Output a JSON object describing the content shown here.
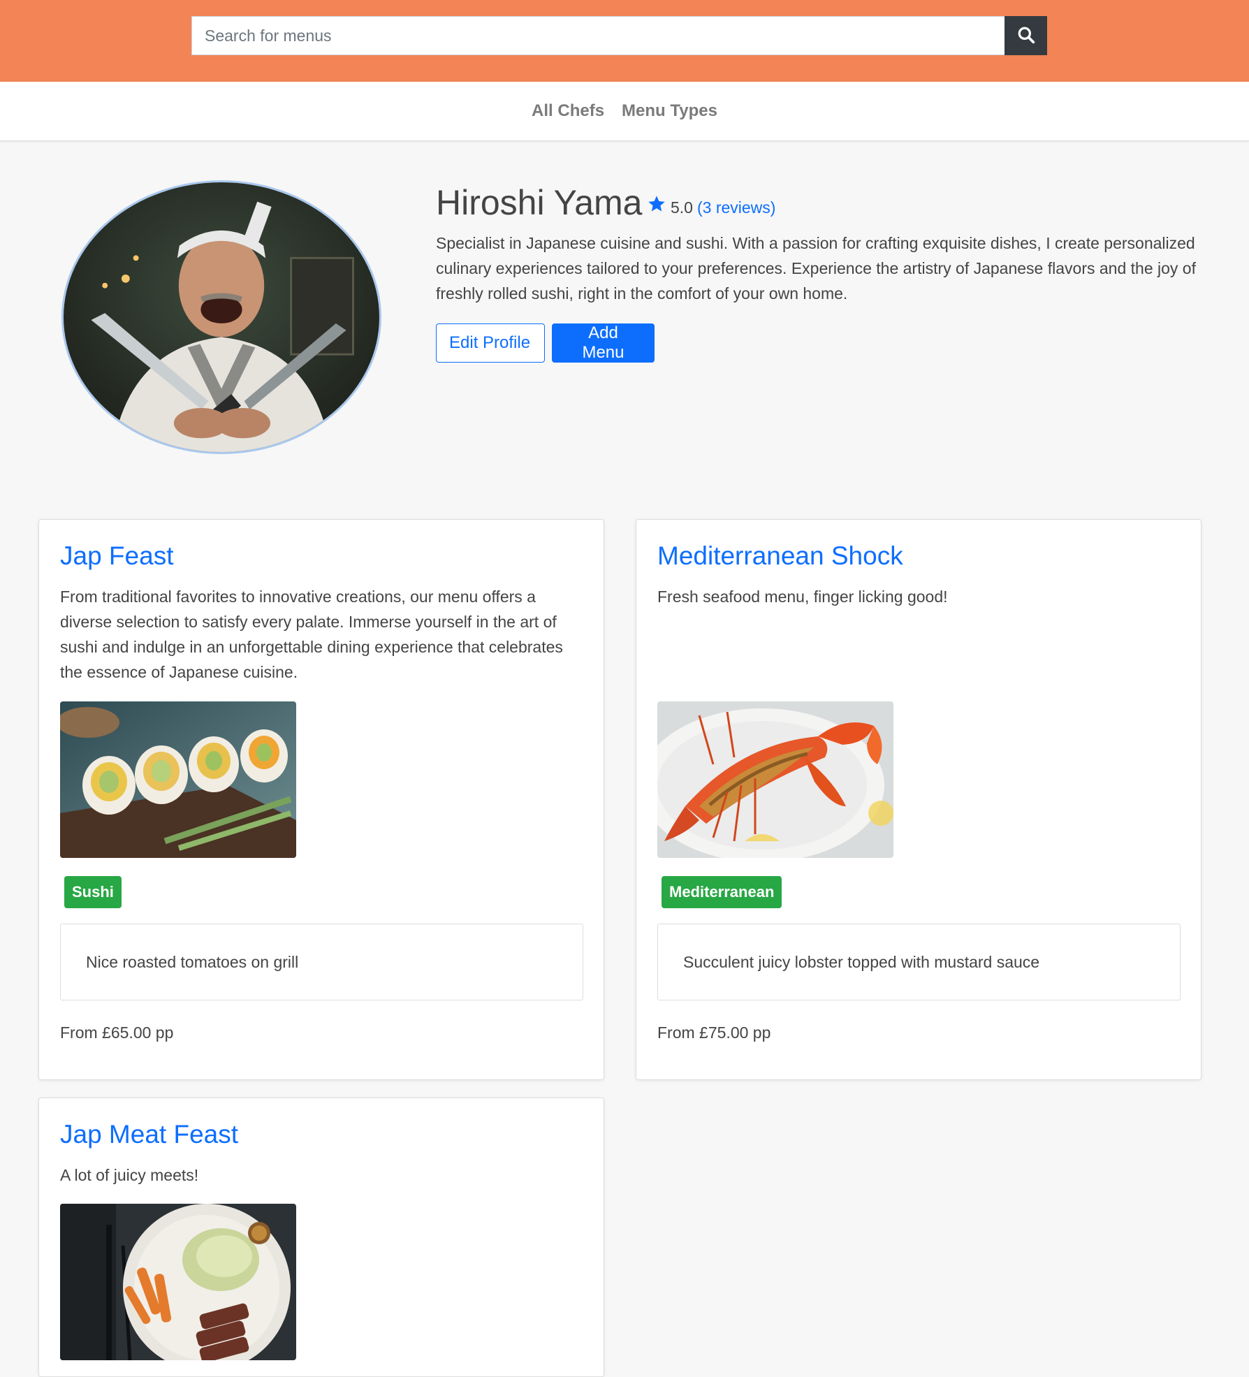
{
  "header": {
    "search_placeholder": "Search for menus",
    "search_icon": "search-icon",
    "background_color": "#f28455"
  },
  "nav": {
    "items": [
      {
        "label": "All Chefs"
      },
      {
        "label": "Menu Types"
      }
    ]
  },
  "profile": {
    "name": "Hiroshi Yama",
    "rating": "5.0",
    "reviews_link": "(3 reviews)",
    "bio": "Specialist in Japanese cuisine and sushi. With a passion for crafting exquisite dishes, I create personalized culinary experiences tailored to your preferences. Experience the artistry of Japanese flavors and the joy of freshly rolled sushi, right in the comfort of your own home.",
    "edit_button": "Edit Profile",
    "add_menu_button": "Add Menu",
    "accent_color": "#0d6efd"
  },
  "menus": [
    {
      "title": "Jap Feast",
      "description": "From traditional favorites to innovative creations, our menu offers a diverse selection to satisfy every palate. Immerse yourself in the art of sushi and indulge in an unforgettable dining experience that celebrates the essence of Japanese cuisine.",
      "tag": "Sushi",
      "dish": "Nice roasted tomatoes on grill",
      "price": "From £65.00 pp"
    },
    {
      "title": "Mediterranean Shock",
      "description": "Fresh seafood menu, finger licking good!",
      "tag": "Mediterranean",
      "dish": "Succulent juicy lobster topped with mustard sauce",
      "price": "From £75.00 pp"
    },
    {
      "title": "Jap Meat Feast",
      "description": "A lot of juicy meets!"
    }
  ],
  "tag_color": "#28a745"
}
